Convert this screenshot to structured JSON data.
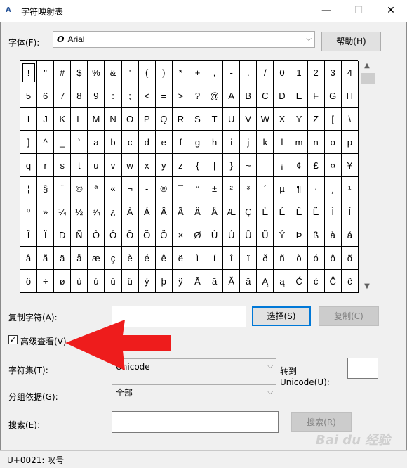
{
  "window": {
    "title": "字符映射表",
    "minimize": "—",
    "maximize": "☐",
    "close": "✕"
  },
  "font_row": {
    "label": "字体(F):",
    "selected_font": "Arial",
    "font_icon": "O",
    "help_button": "帮助(H)"
  },
  "grid": {
    "rows": [
      [
        "!",
        "\"",
        "#",
        "$",
        "%",
        "&",
        "'",
        "(",
        ")",
        "*",
        "+",
        ",",
        "-",
        ".",
        "/",
        "0",
        "1",
        "2",
        "3",
        "4"
      ],
      [
        "5",
        "6",
        "7",
        "8",
        "9",
        ":",
        ";",
        "<",
        "=",
        ">",
        "?",
        "@",
        "A",
        "B",
        "C",
        "D",
        "E",
        "F",
        "G",
        "H"
      ],
      [
        "I",
        "J",
        "K",
        "L",
        "M",
        "N",
        "O",
        "P",
        "Q",
        "R",
        "S",
        "T",
        "U",
        "V",
        "W",
        "X",
        "Y",
        "Z",
        "[",
        "\\"
      ],
      [
        "]",
        "^",
        "_",
        "`",
        "a",
        "b",
        "c",
        "d",
        "e",
        "f",
        "g",
        "h",
        "i",
        "j",
        "k",
        "l",
        "m",
        "n",
        "o",
        "p"
      ],
      [
        "q",
        "r",
        "s",
        "t",
        "u",
        "v",
        "w",
        "x",
        "y",
        "z",
        "{",
        "|",
        "}",
        "~",
        " ",
        "¡",
        "¢",
        "£",
        "¤",
        "¥"
      ],
      [
        "¦",
        "§",
        "¨",
        "©",
        "ª",
        "«",
        "¬",
        "-",
        "®",
        "¯",
        "°",
        "±",
        "²",
        "³",
        "´",
        "µ",
        "¶",
        "·",
        "¸",
        "¹"
      ],
      [
        "º",
        "»",
        "¼",
        "½",
        "¾",
        "¿",
        "À",
        "Á",
        "Â",
        "Ã",
        "Ä",
        "Å",
        "Æ",
        "Ç",
        "È",
        "É",
        "Ê",
        "Ë",
        "Ì",
        "Í"
      ],
      [
        "Î",
        "Ï",
        "Ð",
        "Ñ",
        "Ò",
        "Ó",
        "Ô",
        "Õ",
        "Ö",
        "×",
        "Ø",
        "Ù",
        "Ú",
        "Û",
        "Ü",
        "Ý",
        "Þ",
        "ß",
        "à",
        "á"
      ],
      [
        "â",
        "ã",
        "ä",
        "å",
        "æ",
        "ç",
        "è",
        "é",
        "ê",
        "ë",
        "ì",
        "í",
        "î",
        "ï",
        "ð",
        "ñ",
        "ò",
        "ó",
        "ô",
        "õ"
      ],
      [
        "ö",
        "÷",
        "ø",
        "ù",
        "ú",
        "û",
        "ü",
        "ý",
        "þ",
        "ÿ",
        "Ā",
        "ā",
        "Ă",
        "ă",
        "Ą",
        "ą",
        "Ć",
        "ć",
        "Ĉ",
        "ĉ"
      ]
    ],
    "selected": [
      0,
      0
    ]
  },
  "copy_row": {
    "label": "复制字符(A):",
    "value": "",
    "select_button": "选择(S)",
    "copy_button": "复制(C)"
  },
  "advanced": {
    "label": "高级查看(V)",
    "checked": "✓"
  },
  "charset": {
    "label": "字符集(T):",
    "value": "Unicode",
    "goto_label_1": "转到",
    "goto_label_2": "Unicode(U):",
    "goto_value": ""
  },
  "group": {
    "label": "分组依据(G):",
    "value": "全部"
  },
  "search": {
    "label": "搜索(E):",
    "value": "",
    "button": "搜索(R)"
  },
  "status": {
    "text": "U+0021: 叹号"
  },
  "colors": {
    "annotation_arrow": "#ee1c1c"
  }
}
